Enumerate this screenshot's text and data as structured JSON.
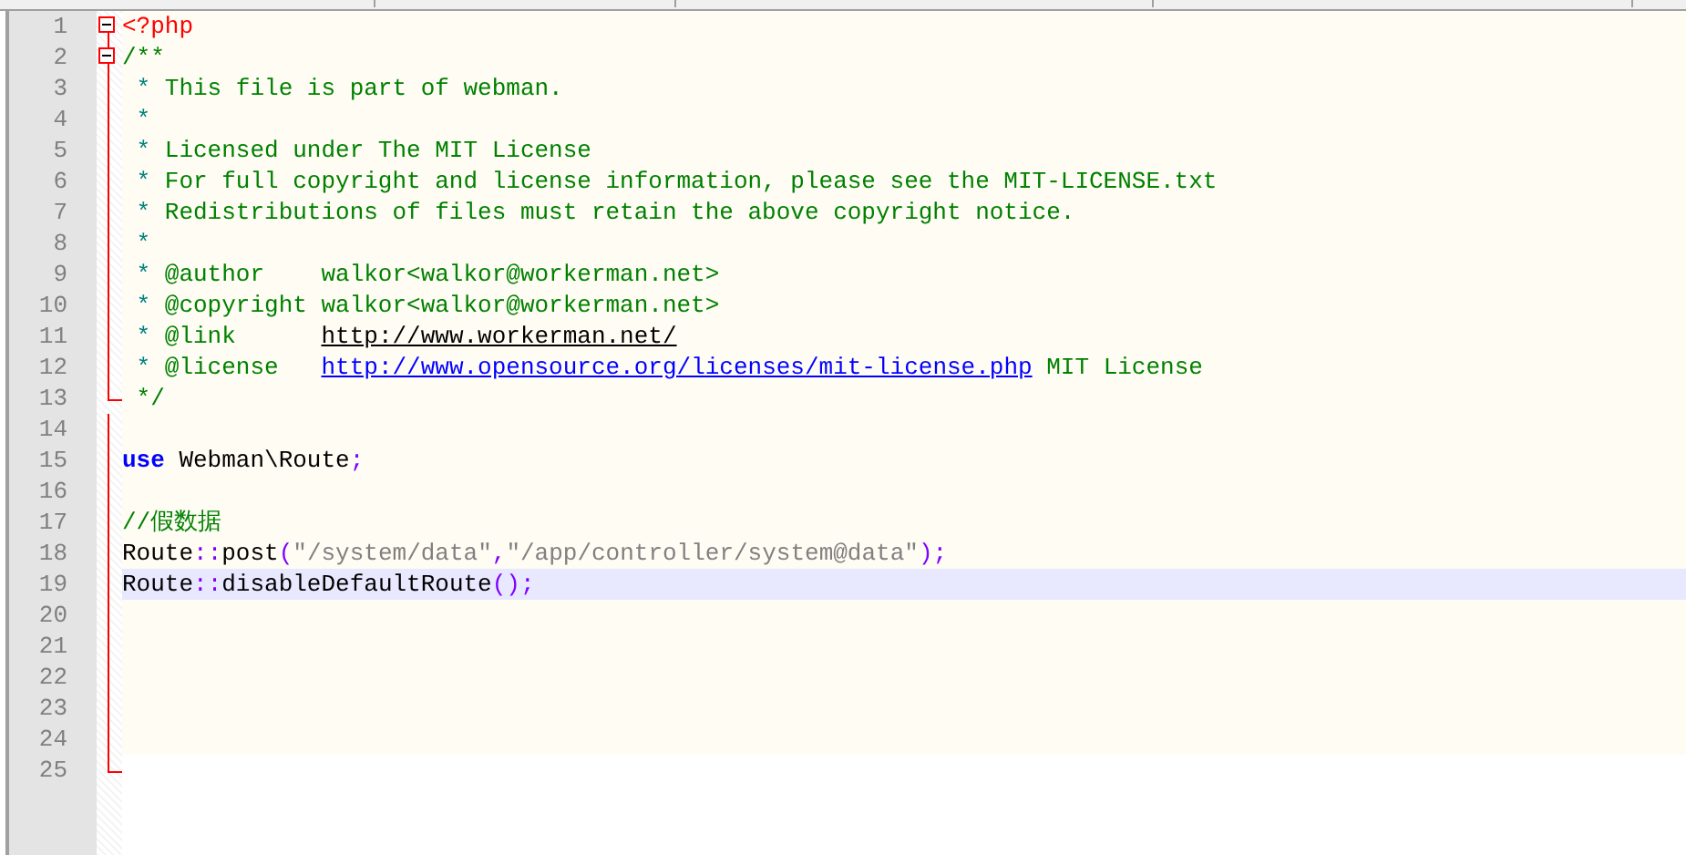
{
  "editor": {
    "lines": [
      {
        "number": "1",
        "current": false,
        "collapsible": true,
        "fold_end": false,
        "tokens": [
          {
            "kind": "tag",
            "text": "<?php"
          }
        ]
      },
      {
        "number": "2",
        "current": false,
        "collapsible": true,
        "fold_end": false,
        "tokens": [
          {
            "kind": "doc",
            "text": "/**"
          }
        ]
      },
      {
        "number": "3",
        "current": false,
        "tokens": [
          {
            "kind": "star",
            "text": " * "
          },
          {
            "kind": "doc",
            "text": "This file is part of webman."
          }
        ]
      },
      {
        "number": "4",
        "current": false,
        "tokens": [
          {
            "kind": "star",
            "text": " *"
          }
        ]
      },
      {
        "number": "5",
        "current": false,
        "tokens": [
          {
            "kind": "star",
            "text": " * "
          },
          {
            "kind": "doc",
            "text": "Licensed under The MIT License"
          }
        ]
      },
      {
        "number": "6",
        "current": false,
        "tokens": [
          {
            "kind": "star",
            "text": " * "
          },
          {
            "kind": "doc",
            "text": "For full copyright and license information, please see the MIT-LICENSE.txt"
          }
        ]
      },
      {
        "number": "7",
        "current": false,
        "tokens": [
          {
            "kind": "star",
            "text": " * "
          },
          {
            "kind": "doc",
            "text": "Redistributions of files must retain the above copyright notice."
          }
        ]
      },
      {
        "number": "8",
        "current": false,
        "tokens": [
          {
            "kind": "star",
            "text": " *"
          }
        ]
      },
      {
        "number": "9",
        "current": false,
        "tokens": [
          {
            "kind": "star",
            "text": " * "
          },
          {
            "kind": "doc",
            "text": "@author    walkor<walkor@workerman.net>"
          }
        ]
      },
      {
        "number": "10",
        "current": false,
        "tokens": [
          {
            "kind": "star",
            "text": " * "
          },
          {
            "kind": "doc",
            "text": "@copyright walkor<walkor@workerman.net>"
          }
        ]
      },
      {
        "number": "11",
        "current": false,
        "tokens": [
          {
            "kind": "star",
            "text": " * "
          },
          {
            "kind": "doc",
            "text": "@link      "
          },
          {
            "kind": "link",
            "text": "http://www.workerman.net/"
          }
        ]
      },
      {
        "number": "12",
        "current": false,
        "tokens": [
          {
            "kind": "star",
            "text": " * "
          },
          {
            "kind": "doc",
            "text": "@license   "
          },
          {
            "kind": "url",
            "text": "http://www.opensource.org/licenses/mit-license.php"
          },
          {
            "kind": "doc",
            "text": " MIT License"
          }
        ]
      },
      {
        "number": "13",
        "current": false,
        "collapsible": false,
        "fold_end": true,
        "tokens": [
          {
            "kind": "doc",
            "text": " */"
          }
        ]
      },
      {
        "number": "14",
        "current": false
      },
      {
        "number": "15",
        "current": false,
        "tokens": [
          {
            "kind": "keyword",
            "text": "use"
          },
          {
            "kind": "plain",
            "text": " Webman\\Route"
          },
          {
            "kind": "op",
            "text": ";"
          }
        ]
      },
      {
        "number": "16",
        "current": false
      },
      {
        "number": "17",
        "current": false,
        "tokens": [
          {
            "kind": "comment",
            "text": "//假数据"
          }
        ]
      },
      {
        "number": "18",
        "current": false,
        "tokens": [
          {
            "kind": "plain",
            "text": "Route"
          },
          {
            "kind": "op",
            "text": "::"
          },
          {
            "kind": "plain",
            "text": "post"
          },
          {
            "kind": "op",
            "text": "("
          },
          {
            "kind": "string",
            "text": "\"/system/data\""
          },
          {
            "kind": "op",
            "text": ","
          },
          {
            "kind": "string",
            "text": "\"/app/controller/system@data\""
          },
          {
            "kind": "op",
            "text": ");"
          }
        ]
      },
      {
        "number": "19",
        "current": true,
        "tokens": [
          {
            "kind": "plain",
            "text": "Route"
          },
          {
            "kind": "op",
            "text": "::"
          },
          {
            "kind": "plain",
            "text": "disableDefaultRoute"
          },
          {
            "kind": "op",
            "text": "();"
          }
        ]
      },
      {
        "number": "20",
        "current": false
      },
      {
        "number": "21",
        "current": false
      },
      {
        "number": "22",
        "current": false
      },
      {
        "number": "23",
        "current": false
      },
      {
        "number": "24",
        "current": false
      },
      {
        "number": "25",
        "current": false,
        "collapsible": false,
        "fold_end": true
      }
    ]
  }
}
